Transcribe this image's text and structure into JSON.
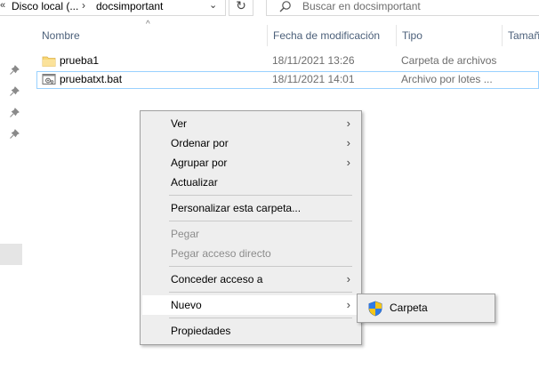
{
  "address_bar": {
    "overflow_chevron": "«",
    "crumb1": "Disco local (...",
    "separator": "›",
    "crumb2": "docsimportant",
    "dropdown_glyph": "⌄"
  },
  "refresh_glyph": "↻",
  "search": {
    "placeholder": "Buscar en docsimportant"
  },
  "columns": {
    "name": "Nombre",
    "date": "Fecha de modificación",
    "type": "Tipo",
    "size": "Tamaño"
  },
  "sort_caret": "^",
  "pin_glyph": "📌",
  "files": [
    {
      "name": "prueba1",
      "date": "18/11/2021 13:26",
      "type": "Carpeta de archivos",
      "icon": "folder-icon"
    },
    {
      "name": "pruebatxt.bat",
      "date": "18/11/2021 14:01",
      "type": "Archivo por lotes ...",
      "icon": "batch-file-icon"
    }
  ],
  "context_menu": {
    "items": [
      {
        "label": "Ver",
        "arrow": "›"
      },
      {
        "label": "Ordenar por",
        "arrow": "›"
      },
      {
        "label": "Agrupar por",
        "arrow": "›"
      },
      {
        "label": "Actualizar"
      },
      {
        "label": "Personalizar esta carpeta..."
      },
      {
        "label": "Pegar"
      },
      {
        "label": "Pegar acceso directo"
      },
      {
        "label": "Conceder acceso a",
        "arrow": "›"
      },
      {
        "label": "Nuevo",
        "arrow": "›"
      },
      {
        "label": "Propiedades"
      }
    ]
  },
  "submenu": {
    "item": "Carpeta",
    "icon": "uac-shield-icon"
  },
  "colors": {
    "header_text": "#4c607a",
    "selection_border": "#99d1ff",
    "menu_bg": "#eeeeee"
  }
}
